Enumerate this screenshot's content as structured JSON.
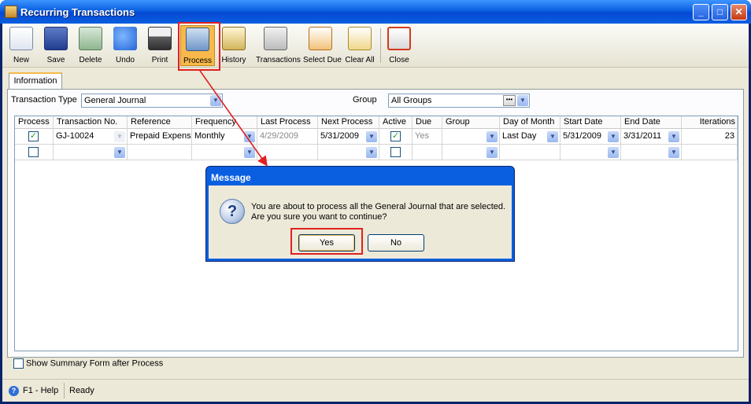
{
  "window": {
    "title": "Recurring Transactions",
    "minimize": "_",
    "maximize": "□",
    "close": "✕"
  },
  "toolbar": {
    "items": [
      {
        "label": "New",
        "icon": "new-document-icon"
      },
      {
        "label": "Save",
        "icon": "floppy-disk-icon"
      },
      {
        "label": "Delete",
        "icon": "recycle-bin-icon"
      },
      {
        "label": "Undo",
        "icon": "undo-arrow-icon"
      },
      {
        "label": "Print",
        "icon": "printer-icon"
      },
      {
        "label": "Process",
        "icon": "gear-process-icon"
      },
      {
        "label": "History",
        "icon": "history-icon"
      },
      {
        "label": "Transactions",
        "icon": "transactions-icon"
      },
      {
        "label": "Select Due",
        "icon": "select-due-icon"
      },
      {
        "label": "Clear All",
        "icon": "clear-all-icon"
      },
      {
        "label": "Close",
        "icon": "close-window-icon"
      }
    ]
  },
  "tabs": [
    {
      "label": "Information"
    }
  ],
  "filters": {
    "transaction_type_label": "Transaction Type",
    "transaction_type_value": "General Journal",
    "group_label": "Group",
    "group_value": "All Groups"
  },
  "grid": {
    "columns": [
      "Process",
      "Transaction No.",
      "Reference",
      "Frequency",
      "Last Process",
      "Next Process",
      "Active",
      "Due",
      "Group",
      "Day of Month",
      "Start Date",
      "End Date",
      "Iterations"
    ],
    "rows": [
      {
        "process": true,
        "transaction_no": "GJ-10024",
        "reference": "Prepaid Expense",
        "frequency": "Monthly",
        "last_process": "4/29/2009",
        "next_process": "5/31/2009",
        "active": true,
        "due": "Yes",
        "group": "",
        "day_of_month": "Last Day",
        "start_date": "5/31/2009",
        "end_date": "3/31/2011",
        "iterations": "23"
      },
      {
        "process": false,
        "transaction_no": "",
        "reference": "",
        "frequency": "",
        "last_process": "",
        "next_process": "",
        "active": false,
        "due": "",
        "group": "",
        "day_of_month": "",
        "start_date": "",
        "end_date": "",
        "iterations": ""
      }
    ]
  },
  "options": {
    "show_summary_label": "Show Summary Form after Process",
    "show_summary_checked": false
  },
  "status": {
    "help": "F1 - Help",
    "state": "Ready"
  },
  "dialog": {
    "title": "Message",
    "message_line1": "You are about to process all the General Journal that are selected.",
    "message_line2": "Are you sure you want to continue?",
    "yes_label": "Yes",
    "no_label": "No",
    "icon": "question-mark-icon"
  },
  "annotation": {
    "highlight_color": "#e02020"
  }
}
